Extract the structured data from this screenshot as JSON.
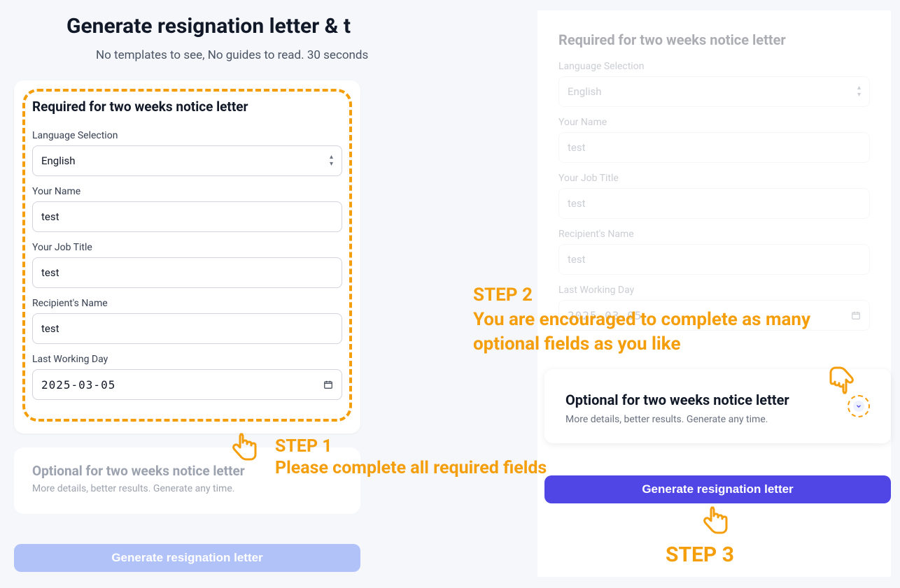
{
  "header": {
    "title": "Generate resignation letter & t",
    "subtitle": "No templates to see, No guides to read. 30 seconds"
  },
  "left": {
    "required_title": "Required for two weeks notice letter",
    "language_label": "Language Selection",
    "language_value": "English",
    "name_label": "Your Name",
    "name_value": "test",
    "job_label": "Your Job Title",
    "job_value": "test",
    "recipient_label": "Recipient's Name",
    "recipient_value": "test",
    "lastday_label": "Last Working Day",
    "lastday_value": "2025-03-05",
    "optional_title": "Optional for two weeks notice letter",
    "optional_sub": "More details, better results. Generate any time.",
    "generate_label": "Generate resignation letter"
  },
  "right": {
    "required_title": "Required for two weeks notice letter",
    "language_label": "Language Selection",
    "language_value": "English",
    "name_label": "Your Name",
    "name_value": "test",
    "job_label": "Your Job Title",
    "job_value": "test",
    "recipient_label": "Recipient's Name",
    "recipient_value": "test",
    "lastday_label": "Last Working Day",
    "lastday_value": "2025-03-05",
    "optional_title": "Optional for two weeks notice letter",
    "optional_sub": "More details, better results. Generate any time.",
    "generate_label": "Generate resignation letter"
  },
  "annotations": {
    "step1_title": "STEP 1",
    "step1_body": "Please complete all required fields",
    "step2_title": "STEP 2",
    "step2_body": "You are encouraged to complete as many optional fields as you like",
    "step3_title": "STEP 3"
  }
}
